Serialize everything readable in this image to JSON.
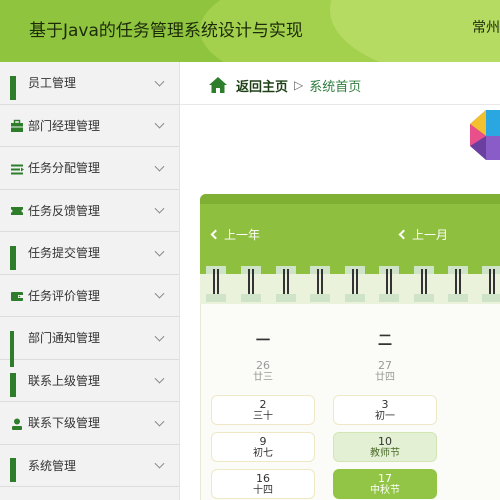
{
  "header": {
    "title": "基于Java的任务管理系统设计与实现",
    "right_text": "常州"
  },
  "sidebar": {
    "items": [
      {
        "label": "员工管理",
        "icon": "grid-icon"
      },
      {
        "label": "部门经理管理",
        "icon": "briefcase-icon"
      },
      {
        "label": "任务分配管理",
        "icon": "list-icon"
      },
      {
        "label": "任务反馈管理",
        "icon": "ticket-icon"
      },
      {
        "label": "任务提交管理",
        "icon": "grid-icon"
      },
      {
        "label": "任务评价管理",
        "icon": "wallet-icon"
      },
      {
        "label": "部门通知管理",
        "icon": "apps-icon"
      },
      {
        "label": "联系上级管理",
        "icon": "grid-icon"
      },
      {
        "label": "联系下级管理",
        "icon": "user-icon"
      },
      {
        "label": "系统管理",
        "icon": "grid-icon"
      }
    ]
  },
  "breadcrumb": {
    "back_home": "返回主页",
    "separator": "▷",
    "current": "系统首页"
  },
  "calendar": {
    "prev_year": "上一年",
    "prev_month": "上一月",
    "weekdays": [
      "一",
      "二"
    ],
    "rows": [
      [
        {
          "n": "26",
          "l": "廿三",
          "type": "prev"
        },
        {
          "n": "27",
          "l": "廿四",
          "type": "prev"
        }
      ],
      [
        {
          "n": "2",
          "l": "三十",
          "type": "cell"
        },
        {
          "n": "3",
          "l": "初一",
          "type": "cell"
        }
      ],
      [
        {
          "n": "9",
          "l": "初七",
          "type": "cell"
        },
        {
          "n": "10",
          "l": "教师节",
          "type": "holiday"
        }
      ],
      [
        {
          "n": "16",
          "l": "十四",
          "type": "cell"
        },
        {
          "n": "17",
          "l": "中秋节",
          "type": "today"
        }
      ]
    ]
  },
  "colors": {
    "header_green": "#8fc43e",
    "accent_dark_green": "#2e7d2a",
    "calendar_header": "#8ebf3e",
    "today": "#92c445"
  }
}
